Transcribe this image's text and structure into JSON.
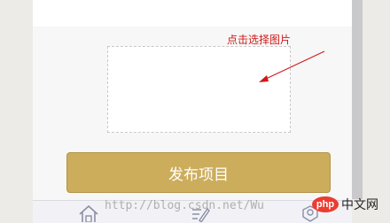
{
  "upload": {
    "hint_label": "点击选择图片"
  },
  "publish": {
    "button_label": "发布项目"
  },
  "tabbar": {
    "icons": [
      "home-icon",
      "edit-icon",
      "user-icon"
    ]
  },
  "watermark": {
    "text": "http://blog.csdn.net/Wu"
  },
  "logo": {
    "badge": "php",
    "text": "中文网"
  },
  "colors": {
    "button": "#ccad5c",
    "hint": "#d01818",
    "logo": "#ec3c2f"
  }
}
